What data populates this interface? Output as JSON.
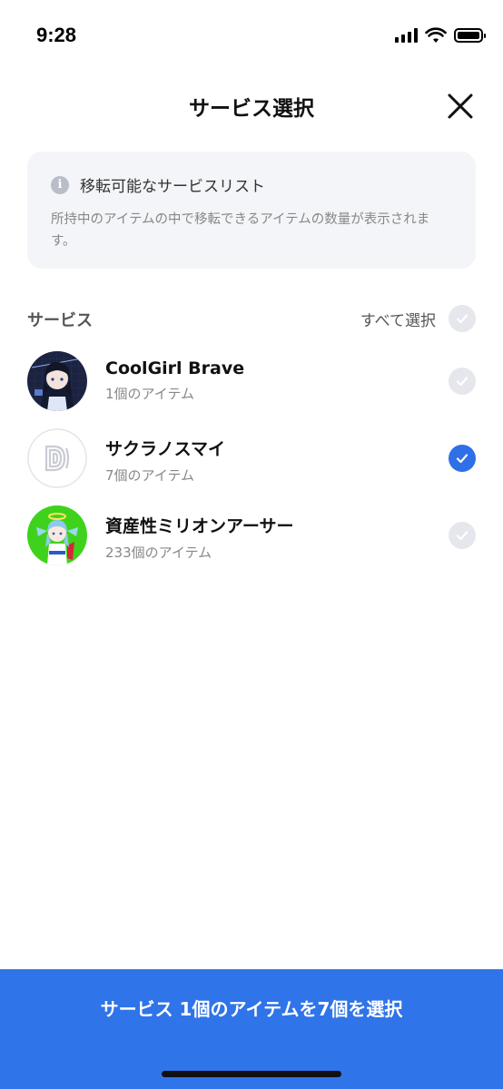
{
  "status_bar": {
    "time": "9:28"
  },
  "header": {
    "title": "サービス選択"
  },
  "info": {
    "title": "移転可能なサービスリスト",
    "description": "所持中のアイテムの中で移転できるアイテムの数量が表示されます。"
  },
  "section": {
    "label": "サービス",
    "select_all_label": "すべて選択"
  },
  "services": [
    {
      "name": "CoolGirl Brave",
      "count": "1個のアイテム",
      "selected": false,
      "icon": "coolgirl-avatar"
    },
    {
      "name": "サクラノスマイ",
      "count": "7個のアイテム",
      "selected": true,
      "icon": "sakura-logo"
    },
    {
      "name": "資産性ミリオンアーサー",
      "count": "233個のアイテム",
      "selected": false,
      "icon": "million-arthur-avatar"
    }
  ],
  "bottom_button": {
    "label": "サービス 1個のアイテムを7個を選択"
  },
  "colors": {
    "accent": "#2f74e8",
    "check_on": "#2f6fe8",
    "check_off": "#e6e7ec"
  }
}
